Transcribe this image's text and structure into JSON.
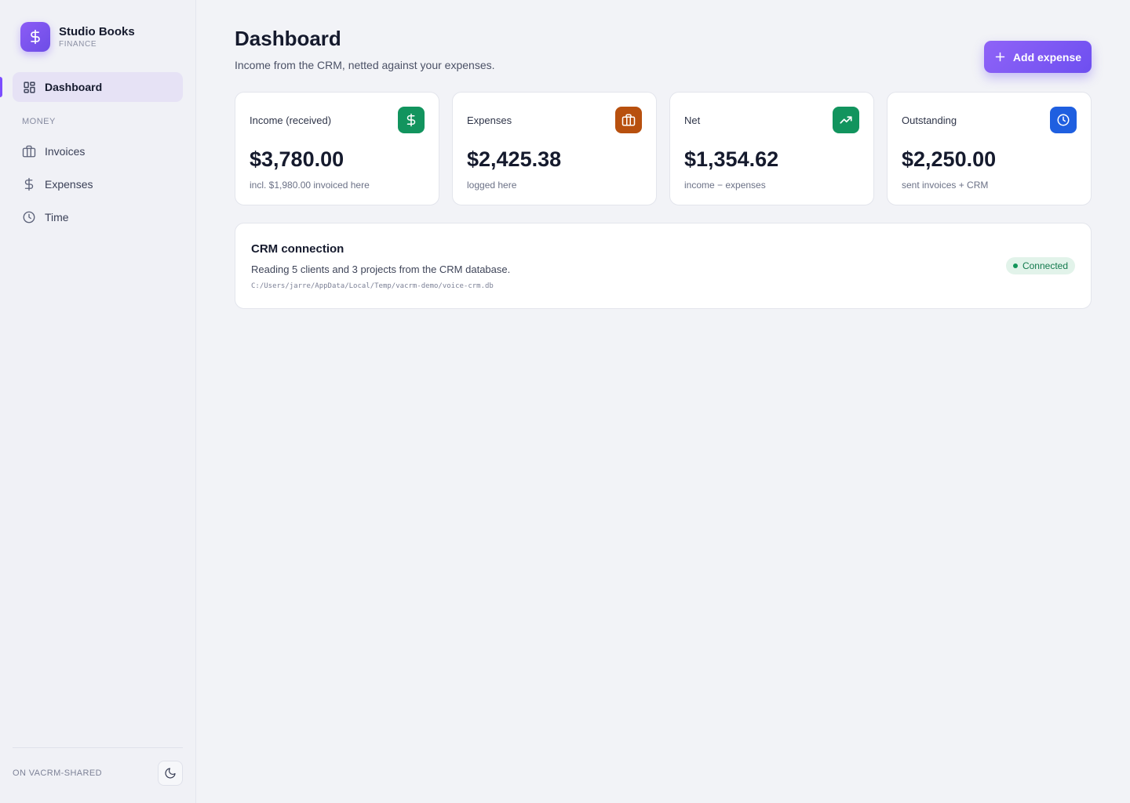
{
  "app": {
    "name": "Studio Books",
    "subtitle": "FINANCE",
    "brand_color": "#7c4dff"
  },
  "sidebar": {
    "items": [
      {
        "label": "Dashboard",
        "icon": "grid-icon",
        "active": true
      }
    ],
    "section_money": "MONEY",
    "money_items": [
      {
        "label": "Invoices",
        "icon": "briefcase-icon"
      },
      {
        "label": "Expenses",
        "icon": "dollar-icon"
      },
      {
        "label": "Time",
        "icon": "clock-icon"
      }
    ],
    "workspace": "ON VACRM-SHARED",
    "theme_toggle_icon": "moon-icon"
  },
  "header": {
    "title": "Dashboard",
    "subtitle": "Income from the CRM, netted against your expenses.",
    "add_button": "Add expense"
  },
  "stats": [
    {
      "label": "Income (received)",
      "value": "$3,780.00",
      "note": "incl. $1,980.00 invoiced here",
      "icon": "dollar-icon",
      "color": "#12945e"
    },
    {
      "label": "Expenses",
      "value": "$2,425.38",
      "note": "logged here",
      "icon": "briefcase-icon",
      "color": "#b8500e"
    },
    {
      "label": "Net",
      "value": "$1,354.62",
      "note": "income − expenses",
      "icon": "trending-up-icon",
      "color": "#12945e"
    },
    {
      "label": "Outstanding",
      "value": "$2,250.00",
      "note": "sent invoices + CRM",
      "icon": "clock-icon",
      "color": "#1f5fe0"
    }
  ],
  "crm": {
    "title": "CRM connection",
    "description": "Reading 5 clients and 3 projects from the CRM database.",
    "path": "C:/Users/jarre/AppData/Local/Temp/vacrm-demo/voice-crm.db",
    "status": "Connected",
    "status_color": "#137a4d"
  }
}
